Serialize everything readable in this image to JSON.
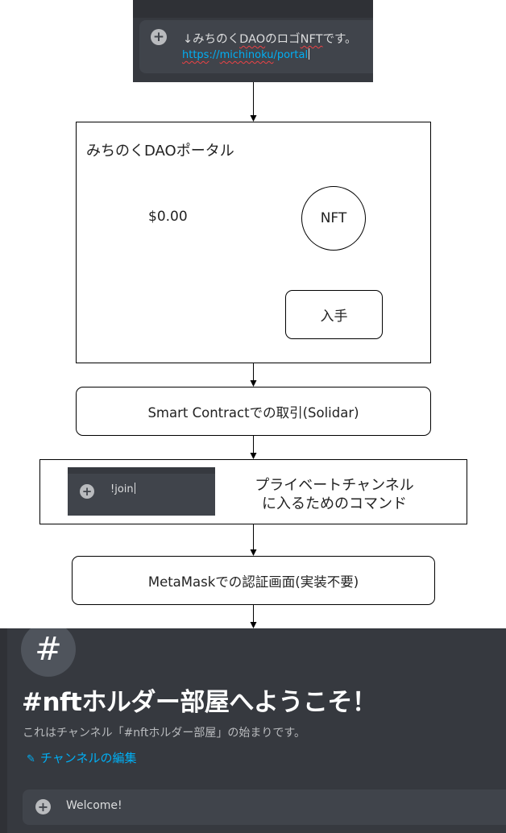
{
  "discord_message": {
    "line1_prefix": "↓みちのく",
    "line1_dao": "DAO",
    "line1_mid": "のロゴ",
    "line1_nft": "NFT",
    "line1_suffix": "です。",
    "link_https": "https",
    "link_colon": "://",
    "link_host": "michinoku",
    "link_path": "/portal"
  },
  "portal": {
    "title": "みちのくDAOポータル",
    "price": "$0.00",
    "nft_label": "NFT",
    "get_button": "入手"
  },
  "steps": {
    "contract": "Smart Contractでの取引(Solidar)",
    "join_command": "!join",
    "join_caption_line1": "プライベートチャンネル",
    "join_caption_line2": "に入るためのコマンド",
    "metamask": "MetaMaskでの認証画面(実装不要)"
  },
  "welcome": {
    "hash_symbol": "#",
    "title": "#nftホルダー部屋へようこそ！",
    "subtitle": "これはチャンネル「#nftホルダー部屋」の始まりです。",
    "edit_link": "チャンネルの編集",
    "message": "Welcome!"
  },
  "icons": {
    "plus": "plus-circle-icon",
    "pencil": "pencil-icon",
    "hash": "hash-icon"
  },
  "colors": {
    "discord_bg": "#36393f",
    "discord_input": "#40444b",
    "discord_link": "#00aff4",
    "spell_error": "#ed4245"
  }
}
